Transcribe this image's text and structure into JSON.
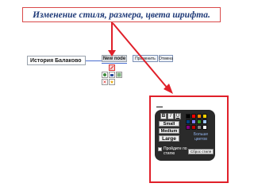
{
  "slide": {
    "title": "Изменение  стиля, размера, цвета шрифта."
  },
  "mindmap": {
    "root_node": "История Балаково",
    "new_node": "New node",
    "buttons": [
      "Применить",
      "Отмена"
    ]
  },
  "style_panel": {
    "format_buttons": [
      "B",
      "I",
      "U"
    ],
    "sizes": [
      "Small",
      "Medium",
      "Large"
    ],
    "more_colors": "Больше цветов",
    "remember": "Пройдите по стилю",
    "reset": "Сброс стиля",
    "colors": [
      "#000000",
      "#ff0000",
      "#ff8800",
      "#ffd200",
      "#004080",
      "#8080ff",
      "#3a9d23",
      "#a0c8ff",
      "#800080",
      "#c00000",
      "#808080",
      "#ffffff"
    ]
  },
  "toolbar": {
    "icons": [
      "highlight-icon",
      "link-icon",
      "delete-icon",
      "star-icon",
      "gear-icon"
    ]
  }
}
